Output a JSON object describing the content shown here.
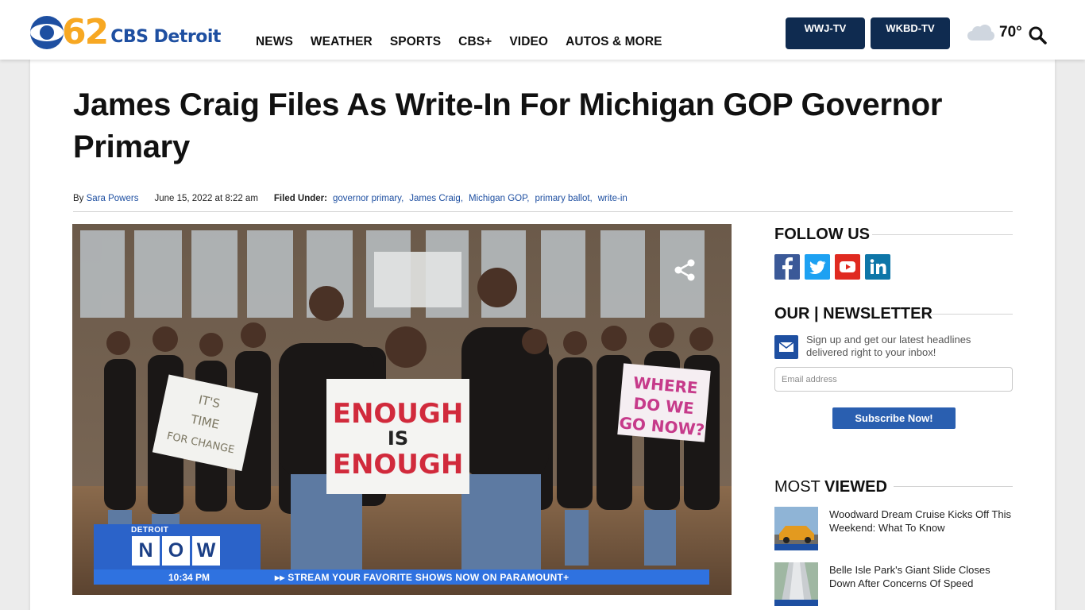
{
  "brand": {
    "number": "62",
    "name": "CBS Detroit"
  },
  "nav": {
    "items": [
      "NEWS",
      "WEATHER",
      "SPORTS",
      "CBS+",
      "VIDEO",
      "AUTOS & MORE"
    ]
  },
  "stations": {
    "wwj": "WWJ-TV",
    "wkbd": "WKBD-TV"
  },
  "weather": {
    "temperature": "70°",
    "icon": "cloud-icon"
  },
  "article": {
    "title": "James Craig Files As Write-In For Michigan GOP Governor Primary",
    "by": "By",
    "author": "Sara Powers",
    "date": "June 15, 2022 at 8:22 am",
    "filed_under": "Filed Under:",
    "tags": [
      "governor primary,",
      "James Craig,",
      "Michigan GOP,",
      "primary ballot,",
      "write-in"
    ]
  },
  "video": {
    "signs": {
      "sign1": [
        "IT'S",
        "TIME",
        "FOR CHANGE"
      ],
      "sign2": [
        "ENOUGH",
        "IS",
        "ENOUGH"
      ],
      "sign3": [
        "WHERE",
        "DO WE",
        "GO NOW?"
      ]
    },
    "ticker": {
      "label": "DETROIT",
      "now": [
        "N",
        "O",
        "W"
      ],
      "time": "10:34 PM",
      "stream": "▸▸  STREAM YOUR FAVORITE SHOWS NOW ON PARAMOUNT+"
    }
  },
  "sidebar": {
    "follow_heading": "FOLLOW US",
    "social": [
      "facebook-icon",
      "twitter-icon",
      "youtube-icon",
      "linkedin-icon"
    ],
    "newsletter_heading": "OUR | NEWSLETTER",
    "newsletter_text": "Sign up and get our latest headlines delivered right to your inbox!",
    "email_placeholder": "Email address",
    "subscribe_label": "Subscribe Now!",
    "most_viewed_prefix": "MOST",
    "most_viewed_suffix": "VIEWED",
    "most_viewed": [
      "Woodward Dream Cruise Kicks Off This Weekend: What To Know",
      "Belle Isle Park's Giant Slide Closes Down After Concerns Of Speed"
    ]
  },
  "colors": {
    "brand_blue": "#1e4fa1",
    "brand_orange": "#f7a823",
    "station_navy": "#0f2b50",
    "link_blue": "#1e4fa1"
  }
}
